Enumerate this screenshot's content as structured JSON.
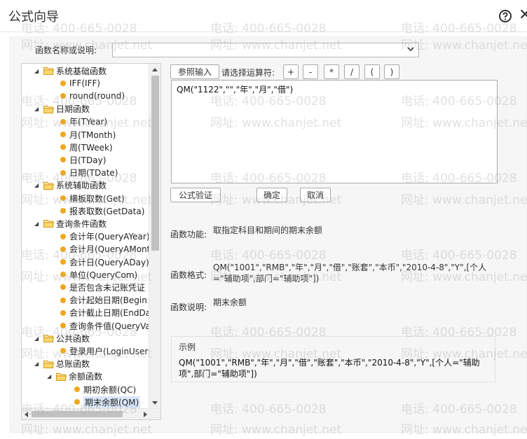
{
  "dialog": {
    "title": "公式向导",
    "help_icon": "question-circle-icon",
    "close_icon": "close-icon",
    "close_glyph": "✕"
  },
  "fn_name": {
    "label": "函数名称或说明:",
    "value": ""
  },
  "tree": {
    "items": [
      {
        "type": "group",
        "label": "系统基础函数",
        "expanded": true
      },
      {
        "type": "leaf",
        "label": "IFF(IFF)"
      },
      {
        "type": "leaf",
        "label": "round(round)"
      },
      {
        "type": "group",
        "label": "日期函数",
        "expanded": true
      },
      {
        "type": "leaf",
        "label": "年(TYear)"
      },
      {
        "type": "leaf",
        "label": "月(TMonth)"
      },
      {
        "type": "leaf",
        "label": "周(TWeek)"
      },
      {
        "type": "leaf",
        "label": "日(TDay)"
      },
      {
        "type": "leaf",
        "label": "日期(TDate)"
      },
      {
        "type": "group",
        "label": "系统辅助函数",
        "expanded": true
      },
      {
        "type": "leaf",
        "label": "横板取数(Get)"
      },
      {
        "type": "leaf",
        "label": "报表取数(GetData)"
      },
      {
        "type": "group",
        "label": "查询条件函数",
        "expanded": true
      },
      {
        "type": "leaf",
        "label": "会计年(QueryAYear)"
      },
      {
        "type": "leaf",
        "label": "会计月(QueryAMont"
      },
      {
        "type": "leaf",
        "label": "会计日(QueryADay)"
      },
      {
        "type": "leaf",
        "label": "单位(QueryCom)"
      },
      {
        "type": "leaf",
        "label": "是否包含未记账凭证"
      },
      {
        "type": "leaf",
        "label": "会计起始日期(Begin"
      },
      {
        "type": "leaf",
        "label": "会计截止日期(EndDa"
      },
      {
        "type": "leaf",
        "label": "查询条件值(QueryVa"
      },
      {
        "type": "group",
        "label": "公共函数",
        "expanded": true
      },
      {
        "type": "leaf",
        "label": "登录用户(LoginUser"
      },
      {
        "type": "group",
        "label": "总账函数",
        "expanded": true
      },
      {
        "type": "group2",
        "label": "余额函数",
        "expanded": true
      },
      {
        "type": "leaf2",
        "label": "期初余额(QC)"
      },
      {
        "type": "leaf2",
        "label": "期末余额(QM)",
        "selected": true
      }
    ]
  },
  "toolbar": {
    "ref_input_label": "参照输入",
    "op_label": "请选择运算符:",
    "ops": [
      "+",
      "-",
      "*",
      "/",
      "(",
      ")"
    ]
  },
  "formula": {
    "value": "QM(\"1122\",\"\",\"年\",\"月\",\"借\")"
  },
  "actions": {
    "verify_label": "公式验证",
    "ok_label": "确定",
    "cancel_label": "取消"
  },
  "info": {
    "function_label": "函数功能:",
    "function_value": "取指定科目和期间的期末余额",
    "format_label": "函数格式:",
    "format_value": "QM(\"1001\",\"RMB\",\"年\",\"月\",\"借\",\"账套\",\"本币\",\"2010-4-8\",\"Y\",[个人=\"辅助项\",部门=\"辅助项\"])",
    "desc_label": "函数说明:",
    "desc_value": "期末余额"
  },
  "example": {
    "title": "示例",
    "text": "QM(\"1001\",\"RMB\",\"年\",\"月\",\"借\",\"账套\",\"本币\",\"2010-4-8\",\"Y\",[个人=\"辅助项\",部门=\"辅助项\"])"
  },
  "watermark": {
    "phone": "电话: 400-665-0028",
    "site": "网址: www.chanjet.net"
  }
}
